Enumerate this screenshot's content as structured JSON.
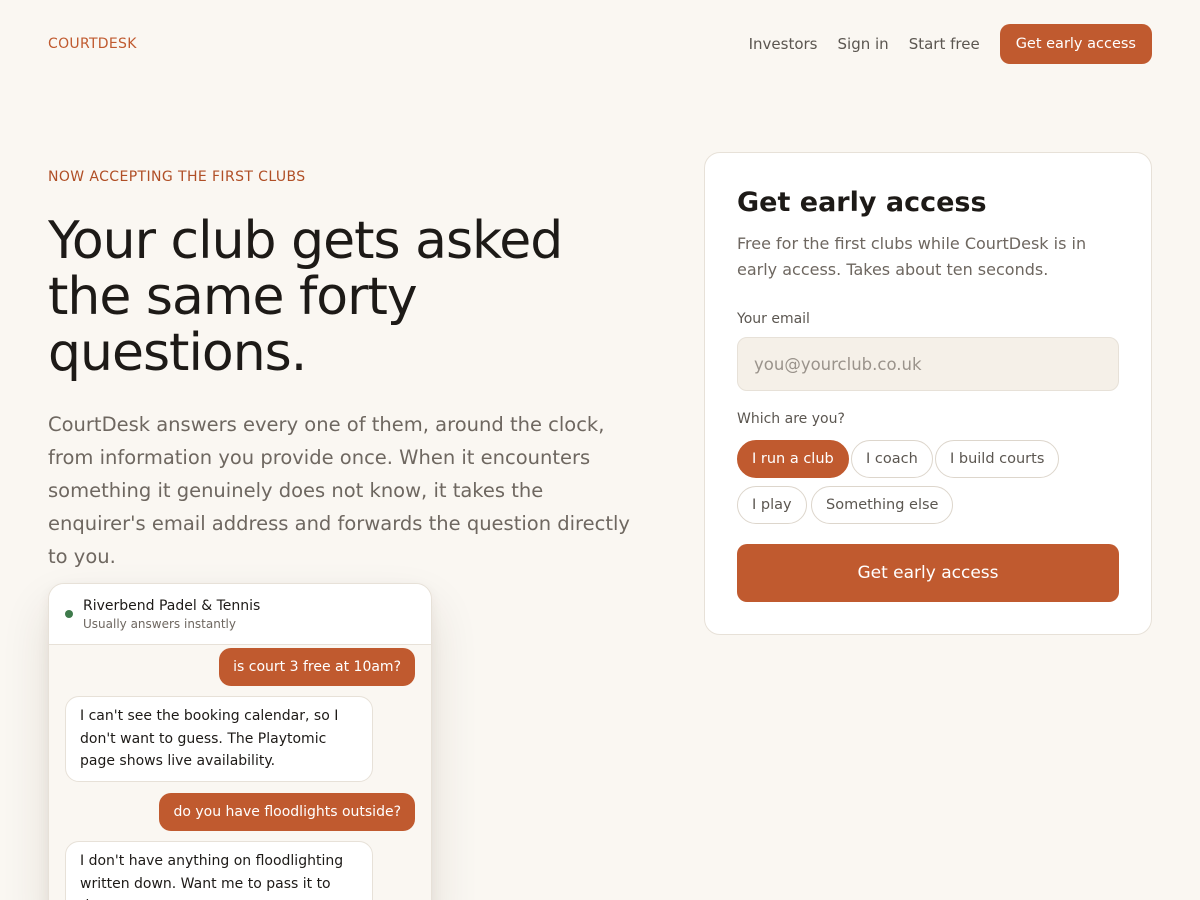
{
  "brand": "COURTDESK",
  "nav": {
    "links": [
      "Investors",
      "Sign in",
      "Start free"
    ],
    "cta": "Get early access"
  },
  "hero": {
    "kicker": "NOW ACCEPTING THE FIRST CLUBS",
    "headline": "Your club gets asked the same forty questions.",
    "lede": "CourtDesk answers every one of them, around the clock, from information you provide once. When it encounters something it genuinely does not know, it takes the enquirer's email address and forwards the question directly to you."
  },
  "chat": {
    "club_name": "Riverbend Padel & Tennis",
    "status": "Usually answers instantly",
    "messages": [
      {
        "from": "user",
        "text": "is court 3 free at 10am?"
      },
      {
        "from": "bot",
        "text": "I can't see the booking calendar, so I don't want to guess. The Playtomic page shows live availability."
      },
      {
        "from": "user",
        "text": "do you have floodlights outside?"
      },
      {
        "from": "bot",
        "text": "I don't have anything on floodlighting written down. Want me to pass it to the"
      }
    ]
  },
  "form": {
    "title": "Get early access",
    "subtitle": "Free for the first clubs while CourtDesk is in early access. Takes about ten seconds.",
    "email_label": "Your email",
    "email_placeholder": "you@yourclub.co.uk",
    "email_value": "",
    "role_label": "Which are you?",
    "roles": [
      "I run a club",
      "I coach",
      "I build courts",
      "I play",
      "Something else"
    ],
    "selected_role": "I run a club",
    "submit": "Get early access"
  },
  "colors": {
    "accent": "#c05a2f",
    "background": "#faf7f2",
    "online_status": "#3e7a4b"
  }
}
